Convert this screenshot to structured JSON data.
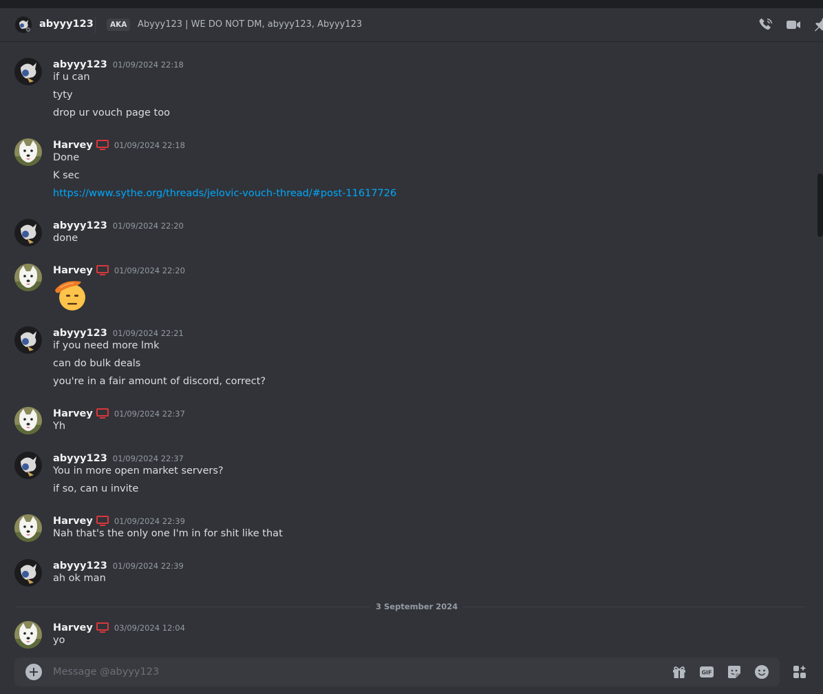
{
  "header": {
    "username": "abyyy123",
    "aka_label": "AKA",
    "aka_names": "Abyyy123 | WE DO NOT DM, abyyy123, Abyyy123",
    "icons": [
      "voice-call-icon",
      "video-call-icon",
      "pin-icon"
    ]
  },
  "messages": [
    {
      "author": "abyyy123",
      "time": "01/09/2024 22:18",
      "lines": [
        "if u can",
        "tyty",
        "drop ur vouch page too"
      ]
    },
    {
      "author": "Harvey",
      "time": "01/09/2024 22:18",
      "lines": [
        "Done",
        "K sec"
      ],
      "link": "https://www.sythe.org/threads/jelovic-vouch-thread/#post-11617726"
    },
    {
      "author": "abyyy123",
      "time": "01/09/2024 22:20",
      "lines": [
        "done"
      ]
    },
    {
      "author": "Harvey",
      "time": "01/09/2024 22:20",
      "emoji": "saluting-face-emoji"
    },
    {
      "author": "abyyy123",
      "time": "01/09/2024 22:21",
      "lines": [
        "if you need more lmk",
        "can do bulk deals",
        "you're in a fair amount of discord, correct?"
      ]
    },
    {
      "author": "Harvey",
      "time": "01/09/2024 22:37",
      "lines": [
        "Yh"
      ]
    },
    {
      "author": "abyyy123",
      "time": "01/09/2024 22:37",
      "lines": [
        "You in more open market servers?",
        "if so, can u invite"
      ]
    },
    {
      "author": "Harvey",
      "time": "01/09/2024 22:39",
      "lines": [
        "Nah that's the only one I'm in for shit like that"
      ]
    },
    {
      "author": "abyyy123",
      "time": "01/09/2024 22:39",
      "lines": [
        "ah ok man"
      ]
    },
    {
      "author": "Harvey",
      "time": "03/09/2024 12:04",
      "lines": [
        "yo"
      ]
    }
  ],
  "date_separator": "3 September 2024",
  "composer": {
    "placeholder": "Message @abyyy123",
    "icons": [
      "gift-icon",
      "gif-icon",
      "sticker-icon",
      "emoji-icon",
      "apps-icon"
    ]
  },
  "colors": {
    "background": "#313338",
    "link": "#00a8fc",
    "monitor_badge": "#da373c"
  }
}
